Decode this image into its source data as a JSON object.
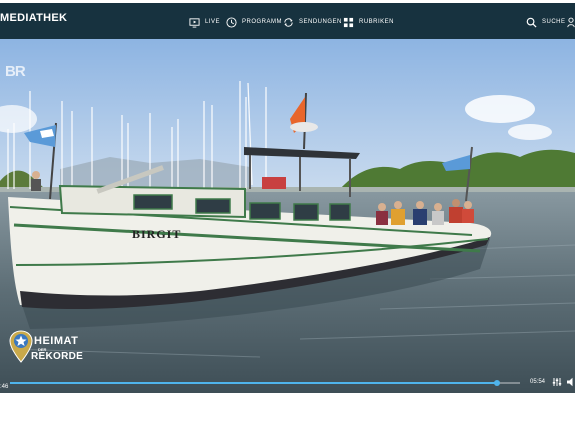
{
  "header": {
    "brand": "MEDIATHEK",
    "nav": {
      "live": "LIVE",
      "programm": "PROGRAMM",
      "sendungen": "SENDUNGEN",
      "rubriken": "RUBRIKEN",
      "suche": "SUCHE"
    }
  },
  "video": {
    "channel_logo": "BR",
    "boat_name": "BIRGIT",
    "show_logo": {
      "title": "HEIMAT",
      "connector": "DER",
      "subtitle": "REKORDE"
    },
    "player": {
      "current_time": ":46",
      "total_time": "05:54",
      "progress_fraction": 0.955
    }
  },
  "colors": {
    "topbar": "#17323f",
    "progress": "#4fb4ec"
  },
  "icons": [
    "live-tv-icon",
    "clock-icon",
    "sendungen-icon",
    "grid-icon",
    "search-icon",
    "user-icon",
    "settings-sliders-icon",
    "volume-icon"
  ]
}
